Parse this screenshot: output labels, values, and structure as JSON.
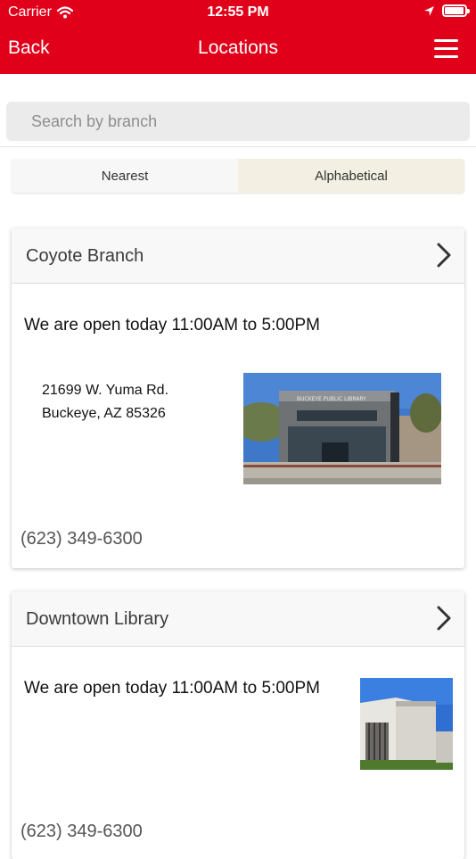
{
  "status_bar": {
    "carrier": "Carrier",
    "time": "12:55 PM",
    "battery_level": 0.95
  },
  "nav": {
    "back_label": "Back",
    "title": "Locations"
  },
  "search": {
    "placeholder": "Search by branch"
  },
  "sort_tabs": {
    "nearest_label": "Nearest",
    "alphabetical_label": "Alphabetical",
    "selected": "Alphabetical"
  },
  "locations": [
    {
      "name": "Coyote Branch",
      "hours": "We are open today 11:00AM to 5:00PM",
      "address_line1": "21699 W. Yuma Rd.",
      "address_line2": "Buckeye, AZ 85326",
      "phone": "(623) 349-6300",
      "photo_sign": "BUCKEYE PUBLIC LIBRARY"
    },
    {
      "name": "Downtown Library",
      "hours": "We are open today 11:00AM to 5:00PM",
      "phone": "(623) 349-6300"
    }
  ],
  "colors": {
    "brand_red": "#e1001a",
    "selected_tab": "#f3f0e3"
  }
}
